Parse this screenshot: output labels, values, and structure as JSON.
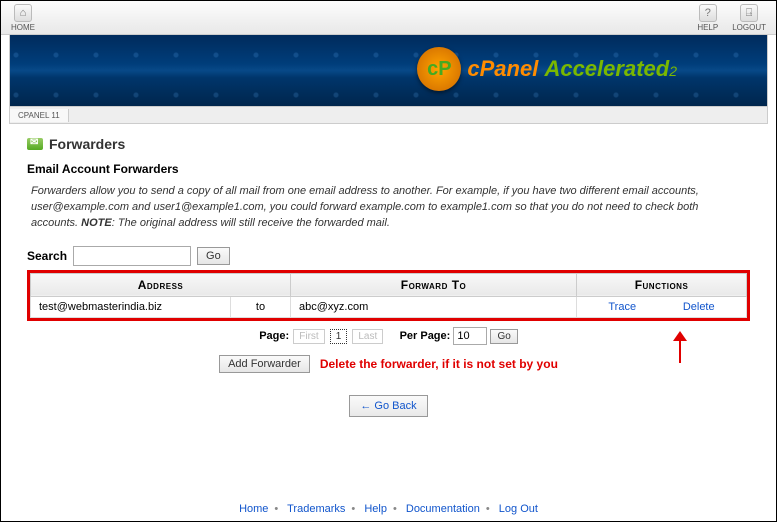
{
  "topbar": {
    "home": "HOME",
    "help": "HELP",
    "logout": "LOGOUT"
  },
  "banner": {
    "brand1": "cPanel",
    "brand2": "Accelerated",
    "sub": "2"
  },
  "tab": "CPANEL 11",
  "page": {
    "title": "Forwarders",
    "subhead": "Email Account Forwarders",
    "desc_pre": "Forwarders allow you to send a copy of all mail from one email address to another. For example, if you have two different email accounts, user@example.com and user1@example1.com, you could forward example.com to example1.com so that you do not need to check both accounts. ",
    "desc_bold": "NOTE",
    "desc_post": ": The original address will still receive the forwarded mail."
  },
  "search": {
    "label": "Search",
    "value": "",
    "go": "Go"
  },
  "table": {
    "h1": "Address",
    "h2": "Forward To",
    "h3": "Functions",
    "row": {
      "addr": "test@webmasterindia.biz",
      "to_word": "to",
      "fwd": "abc@xyz.com",
      "trace": "Trace",
      "delete": "Delete"
    }
  },
  "pager": {
    "page_label": "Page:",
    "first": "First",
    "num": "1",
    "last": "Last",
    "perpage_label": "Per Page:",
    "perpage_value": "10",
    "go": "Go"
  },
  "add_btn": "Add Forwarder",
  "annotation": "Delete the forwarder, if it is not set by you",
  "back": "← Go Back",
  "footer": {
    "home": "Home",
    "tm": "Trademarks",
    "help": "Help",
    "doc": "Documentation",
    "logout": "Log Out"
  }
}
